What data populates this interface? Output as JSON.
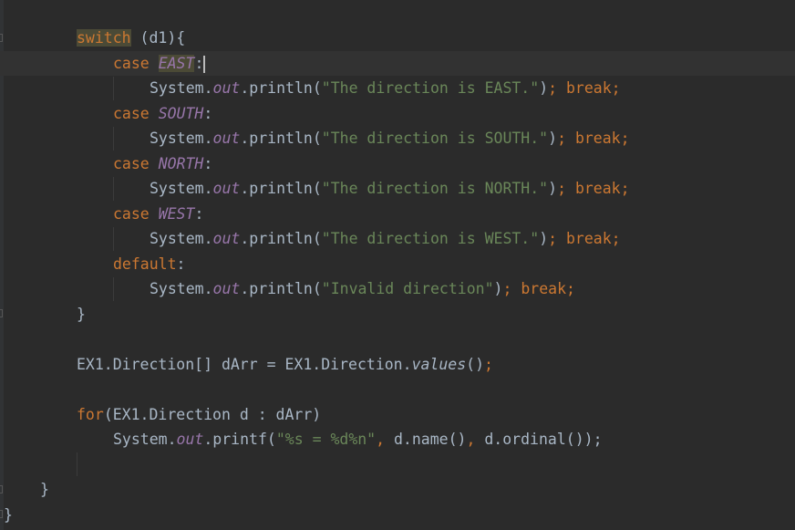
{
  "code": {
    "switch_kw": "switch",
    "switch_arg": " (d1){",
    "case_kw": "case",
    "colon": ":",
    "sysout": "System.",
    "out": "out",
    "println": ".println(",
    "printf": ".printf(",
    "close_paren": ")",
    "semicolon": ";",
    "break_kw": "break;",
    "east": "EAST",
    "south": "SOUTH",
    "north": "NORTH",
    "west": "WEST",
    "str_east": "\"The direction is EAST.\"",
    "str_south": "\"The direction is SOUTH.\"",
    "str_north": "\"The direction is NORTH.\"",
    "str_west": "\"The direction is WEST.\"",
    "default_kw": "default",
    "str_invalid": "\"Invalid direction\"",
    "close_brace": "}",
    "arr_decl": "EX1.Direction[] dArr = EX1.Direction.",
    "values_method": "values",
    "call_parens": "()",
    "for_kw": "for",
    "for_header": "(EX1.Direction d : dArr)",
    "printf_str": "\"%s = %d%n\"",
    "printf_args_1": ", ",
    "printf_args_2": "d.name()",
    "printf_args_3": ", ",
    "printf_args_4": "d.ordinal());",
    "outer_close": "}",
    "class_close": "}"
  }
}
